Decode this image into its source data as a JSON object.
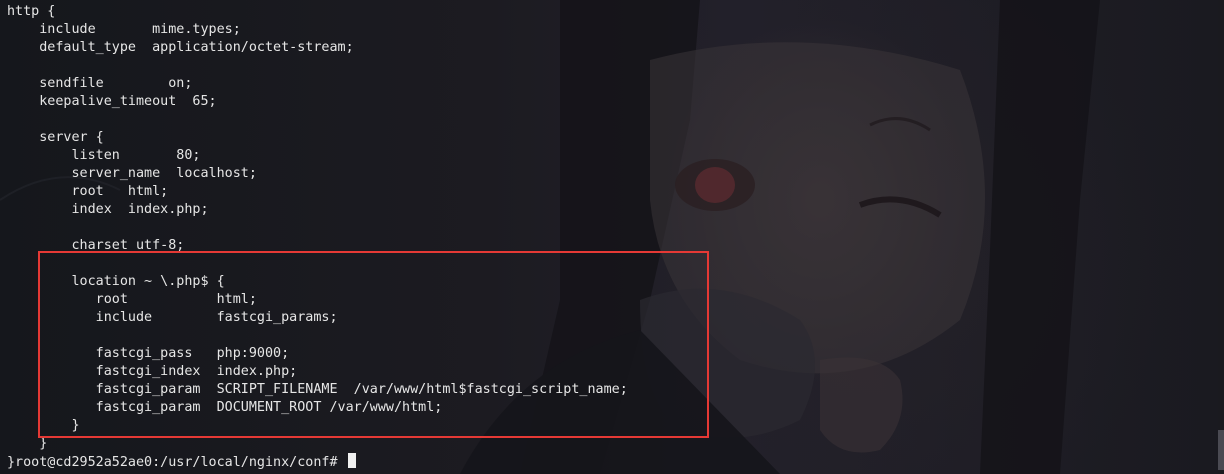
{
  "terminal": {
    "lines": [
      "http {",
      "    include       mime.types;",
      "    default_type  application/octet-stream;",
      "",
      "    sendfile        on;",
      "    keepalive_timeout  65;",
      "",
      "    server {",
      "        listen       80;",
      "        server_name  localhost;",
      "        root   html;",
      "        index  index.php;",
      "",
      "        charset utf-8;",
      "",
      "        location ~ \\.php$ {",
      "           root           html;",
      "           include        fastcgi_params;",
      "",
      "           fastcgi_pass   php:9000;",
      "           fastcgi_index  index.php;",
      "           fastcgi_param  SCRIPT_FILENAME  /var/www/html$fastcgi_script_name;",
      "           fastcgi_param  DOCUMENT_ROOT /var/www/html;",
      "        }",
      "    }",
      "}root@cd2952a52ae0:/usr/local/nginx/conf# "
    ]
  },
  "colors": {
    "text": "#e6e6e6",
    "highlight": "#e53935",
    "background": "#1b1a20"
  }
}
